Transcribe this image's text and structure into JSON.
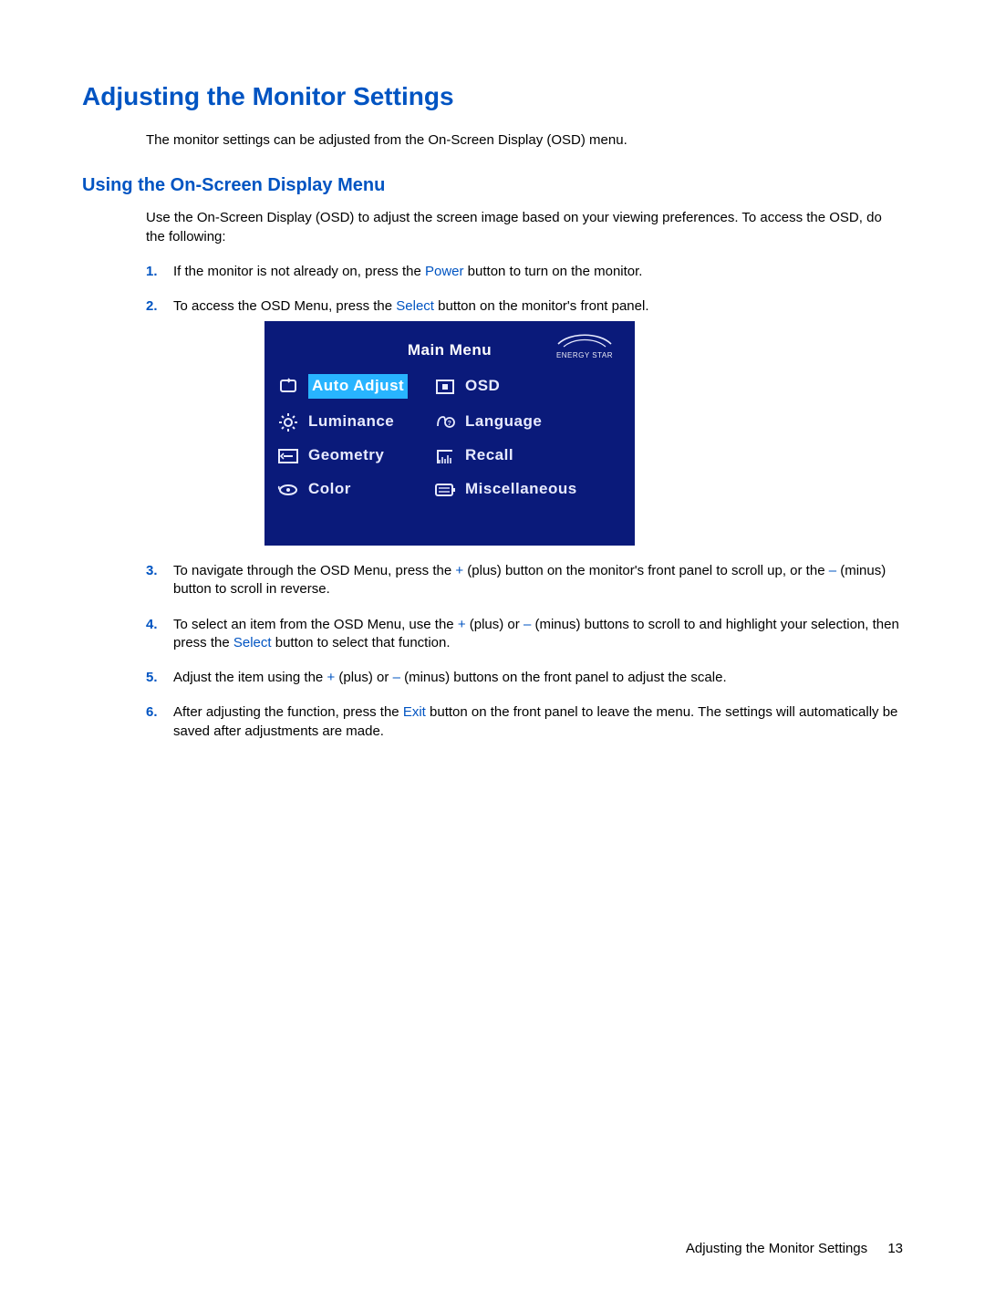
{
  "heading": "Adjusting the Monitor Settings",
  "intro": "The monitor settings can be adjusted from the On-Screen Display (OSD) menu.",
  "subheading": "Using the On-Screen Display Menu",
  "lead": "Use the On-Screen Display (OSD) to adjust the screen image based on your viewing preferences. To access the OSD, do the following:",
  "steps": {
    "s1": {
      "num": "1.",
      "a": "If the monitor is not already on, press the ",
      "kw1": "Power",
      "b": " button to turn on the monitor."
    },
    "s2": {
      "num": "2.",
      "a": "To access the OSD Menu, press the ",
      "kw1": "Select",
      "b": " button on the monitor's front panel."
    },
    "s3": {
      "num": "3.",
      "a": "To navigate through the OSD Menu, press the ",
      "kw1": "+",
      "b": " (plus) button on the monitor's front panel to scroll up, or the ",
      "kw2": "–",
      "c": " (minus) button to scroll in reverse."
    },
    "s4": {
      "num": "4.",
      "a": "To select an item from the OSD Menu, use the ",
      "kw1": "+",
      "b": " (plus) or ",
      "kw2": "–",
      "c": " (minus) buttons to scroll to and highlight your selection, then press the ",
      "kw3": "Select",
      "d": " button to select that function."
    },
    "s5": {
      "num": "5.",
      "a": "Adjust the item using the ",
      "kw1": "+",
      "b": " (plus) or ",
      "kw2": "–",
      "c": " (minus) buttons on the front panel to adjust the scale."
    },
    "s6": {
      "num": "6.",
      "a": "After adjusting the function, press the ",
      "kw1": "Exit",
      "b": " button on the front panel to leave the menu. The settings will automatically be saved after adjustments are made."
    }
  },
  "osd": {
    "title": "Main Menu",
    "logo_tag": "ENERGY STAR",
    "items": {
      "auto_adjust": "Auto Adjust",
      "osd_item": "OSD",
      "luminance": "Luminance",
      "language": "Language",
      "geometry": "Geometry",
      "recall": "Recall",
      "color": "Color",
      "miscellaneous": "Miscellaneous"
    }
  },
  "footer": {
    "title": "Adjusting the Monitor Settings",
    "page": "13"
  }
}
